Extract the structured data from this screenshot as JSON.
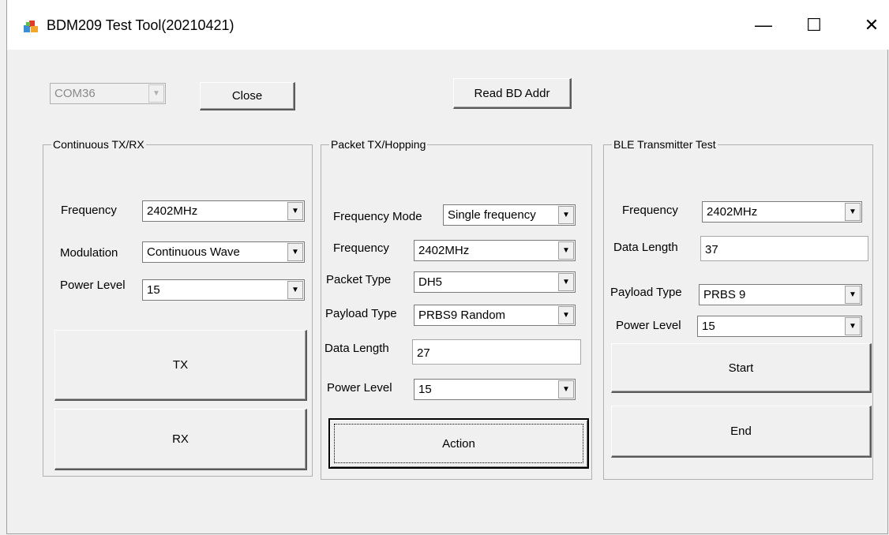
{
  "window": {
    "title": "BDM209 Test Tool(20210421)",
    "minimize_glyph": "—",
    "maximize_glyph": "☐",
    "close_glyph": "✕"
  },
  "top": {
    "port": "COM36",
    "close_button": "Close",
    "read_button": "Read BD Addr"
  },
  "continuous": {
    "group_title": "Continuous TX/RX",
    "frequency_label": "Frequency",
    "frequency_value": "2402MHz",
    "modulation_label": "Modulation",
    "modulation_value": "Continuous Wave",
    "power_label": "Power Level",
    "power_value": "15",
    "tx_button": "TX",
    "rx_button": "RX"
  },
  "packet": {
    "group_title": "Packet TX/Hopping",
    "mode_label": "Frequency Mode",
    "mode_value": "Single frequency",
    "frequency_label": "Frequency",
    "frequency_value": "2402MHz",
    "packet_type_label": "Packet Type",
    "packet_type_value": "DH5",
    "payload_label": "Payload Type",
    "payload_value": "PRBS9 Random",
    "length_label": "Data Length",
    "length_value": "27",
    "power_label": "Power Level",
    "power_value": "15",
    "action_button": "Action"
  },
  "ble": {
    "group_title": "BLE Transmitter Test",
    "frequency_label": "Frequency",
    "frequency_value": "2402MHz",
    "length_label": "Data Length",
    "length_value": "37",
    "payload_label": "Payload Type",
    "payload_value": "PRBS 9",
    "power_label": "Power Level",
    "power_value": "15",
    "start_button": "Start",
    "end_button": "End"
  },
  "icons": {
    "dropdown": "▼"
  }
}
